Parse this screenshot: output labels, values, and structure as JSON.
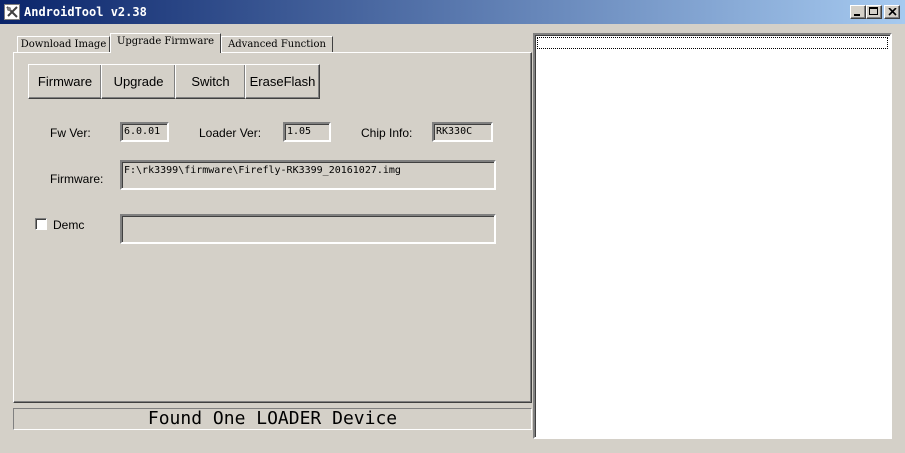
{
  "window": {
    "title": "AndroidTool v2.38"
  },
  "tabs": [
    {
      "label": "Download Image",
      "active": false
    },
    {
      "label": "Upgrade Firmware",
      "active": true
    },
    {
      "label": "Advanced Function",
      "active": false
    }
  ],
  "toolbar": {
    "firmware_label": "Firmware",
    "upgrade_label": "Upgrade",
    "switch_label": "Switch",
    "eraseflash_label": "EraseFlash"
  },
  "info": {
    "fw_ver_label": "Fw Ver:",
    "fw_ver_value": "6.0.01",
    "loader_ver_label": "Loader Ver:",
    "loader_ver_value": "1.05",
    "chip_info_label": "Chip Info:",
    "chip_info_value": "RK330C",
    "firmware_label": "Firmware:",
    "firmware_path": "F:\\rk3399\\firmware\\Firefly-RK3399_20161027.img"
  },
  "demo": {
    "label": "Demc",
    "checked": false,
    "value": ""
  },
  "status": {
    "text": "Found One LOADER Device"
  },
  "colors": {
    "titlebar_start": "#0a246a",
    "titlebar_end": "#a6caf0",
    "face": "#d4d0c8"
  }
}
